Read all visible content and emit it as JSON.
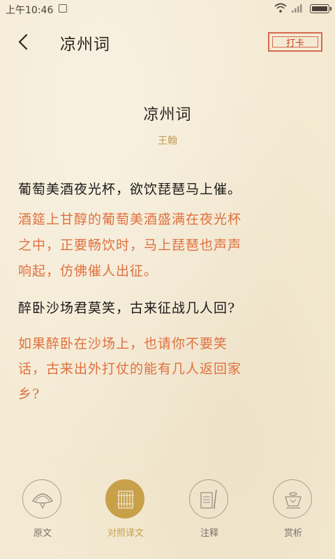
{
  "status_bar": {
    "time": "上午10:46"
  },
  "header": {
    "title": "凉州词",
    "checkin_label": "打卡"
  },
  "poem": {
    "title": "凉州词",
    "author": "王翰",
    "lines": [
      {
        "original": "葡萄美酒夜光杯，欲饮琵琶马上催。",
        "translation": [
          "酒筵上甘醇的葡萄美酒盛满在夜光杯",
          "之中，正要畅饮时，马上琵琶也声声",
          "响起，仿佛催人出征。"
        ]
      },
      {
        "original": "醉卧沙场君莫笑，古来征战几人回?",
        "translation": [
          "如果醉卧在沙场上，也请你不要笑",
          "话，古来出外打仗的能有几人返回家",
          "乡?"
        ]
      }
    ]
  },
  "bottom_nav": {
    "items": [
      {
        "label": "原文",
        "icon": "fan-icon",
        "active": false
      },
      {
        "label": "对照译文",
        "icon": "bamboo-scroll-icon",
        "active": true
      },
      {
        "label": "注释",
        "icon": "brush-paper-icon",
        "active": false
      },
      {
        "label": "赏析",
        "icon": "teapot-icon",
        "active": false
      }
    ]
  },
  "colors": {
    "background": "#f4ead3",
    "translation_text": "#e0703f",
    "accent_gold": "#c8a04a",
    "stamp_red": "#d56a4f"
  }
}
